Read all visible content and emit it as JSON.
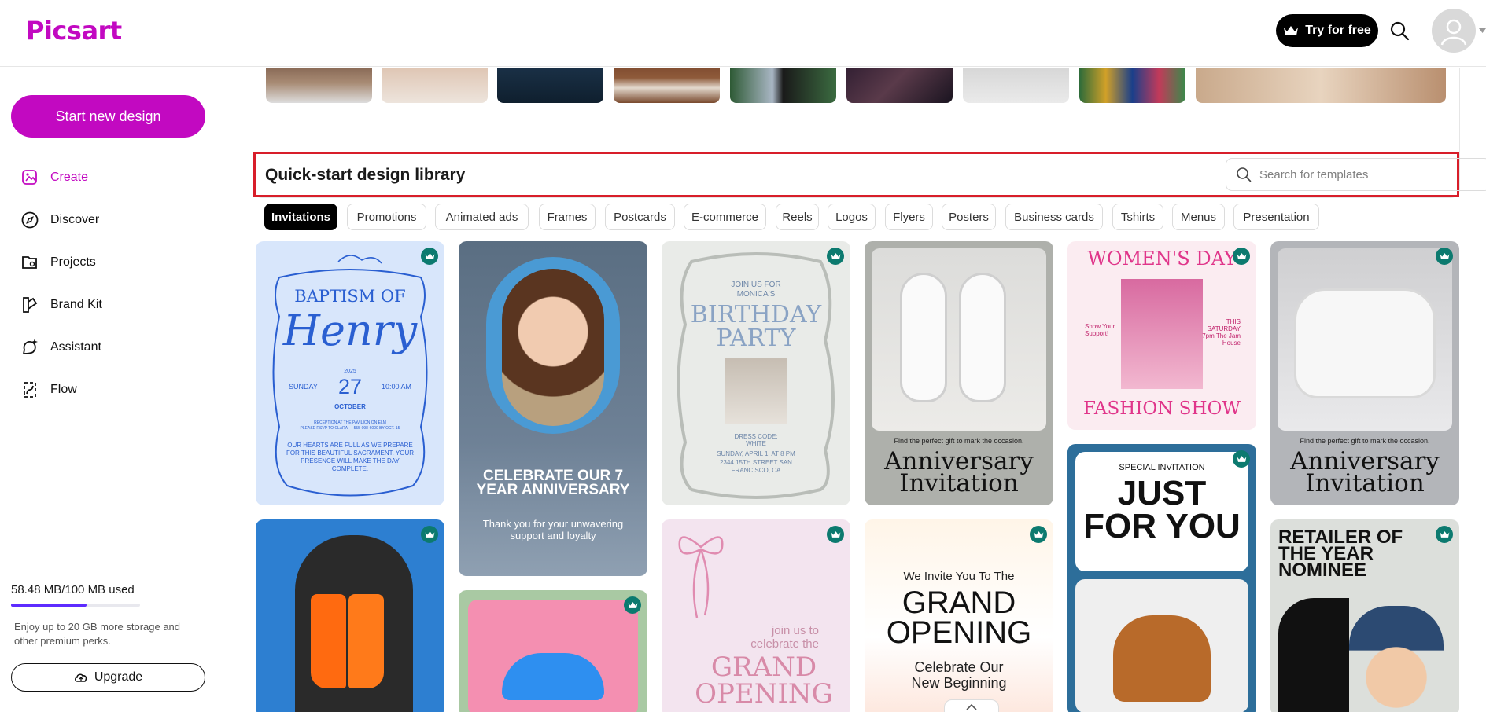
{
  "header": {
    "logo": "Picsart",
    "try_label": "Try for free",
    "icons": [
      "crown-icon",
      "search-icon",
      "avatar-icon",
      "chevron-down-icon"
    ]
  },
  "sidebar": {
    "start_label": "Start new design",
    "items": [
      {
        "label": "Create",
        "icon": "create-icon",
        "active": true
      },
      {
        "label": "Discover",
        "icon": "compass-icon",
        "active": false
      },
      {
        "label": "Projects",
        "icon": "projects-icon",
        "active": false
      },
      {
        "label": "Brand Kit",
        "icon": "brand-kit-icon",
        "active": false
      },
      {
        "label": "Assistant",
        "icon": "assistant-icon",
        "active": false
      },
      {
        "label": "Flow",
        "icon": "flow-icon",
        "active": false
      }
    ],
    "storage_used": "58.48 MB/100 MB used",
    "storage_fraction": 0.585,
    "storage_desc": "Enjoy up to 20 GB more storage and other premium perks.",
    "upgrade_label": "Upgrade"
  },
  "library": {
    "title": "Quick-start design library",
    "search_placeholder": "Search for templates",
    "chips": [
      "Invitations",
      "Promotions",
      "Animated ads",
      "Frames",
      "Postcards",
      "E-commerce",
      "Reels",
      "Logos",
      "Flyers",
      "Posters",
      "Business cards",
      "Tshirts",
      "Menus",
      "Presentation"
    ],
    "active_chip": "Invitations"
  },
  "cards": {
    "baptism": {
      "title1": "BAPTISM OF",
      "title2": "Henry",
      "year": "2025",
      "day": "SUNDAY",
      "date": "27",
      "time": "10:00 AM",
      "month": "OCTOBER",
      "reception": "RECEPTION AT THE PAVILION ON ELM",
      "rsvp": "PLEASE RSVP TO CLARA — 555-098-6000 BY OCT. 15",
      "body": "OUR HEARTS ARE FULL AS WE PREPARE FOR THIS BEAUTIFUL SACRAMENT. YOUR PRESENCE WILL MAKE THE DAY COMPLETE."
    },
    "anniversary7": {
      "title": "CELEBRATE OUR 7 YEAR ANNIVERSARY",
      "subtitle": "Thank you for your unwavering support and loyalty"
    },
    "birthday": {
      "line1": "JOIN US FOR",
      "line2": "MONICA'S",
      "title1": "BIRTHDAY",
      "title2": "PARTY",
      "dress": "DRESS CODE: WHITE",
      "when": "SUNDAY, APRIL 1, AT 8 PM",
      "where": "2344 15TH STREET SAN FRANCISCO, CA"
    },
    "anniv_shoes": {
      "tagline": "Find the perfect gift to mark the occasion.",
      "title1": "Anniversary",
      "title2": "Invitation"
    },
    "womens_day": {
      "title": "WOMEN'S DAY",
      "left": "Show Your Support!",
      "right": "THIS SATURDAY 7pm The Jam House",
      "bottom": "FASHION SHOW"
    },
    "anniv_sandals": {
      "tagline": "Find the perfect gift to mark the occasion.",
      "title1": "Anniversary",
      "title2": "Invitation"
    },
    "grand_pink": {
      "line": "join us to celebrate the",
      "title1": "GRAND",
      "title2": "OPENING"
    },
    "grand_white": {
      "line": "We Invite You To The",
      "title1": "GRAND",
      "title2": "OPENING",
      "sub1": "Celebrate Our",
      "sub2": "New Beginning"
    },
    "special": {
      "label": "SPECIAL INVITATION",
      "title1": "JUST",
      "title2": "FOR YOU"
    },
    "retailer": {
      "title": "RETAILER OF THE YEAR NOMINEE"
    }
  },
  "colors": {
    "brand": "#c209c1",
    "storage": "#5d2bff",
    "highlight": "#d81e2a",
    "premium": "#0c7a6f"
  }
}
